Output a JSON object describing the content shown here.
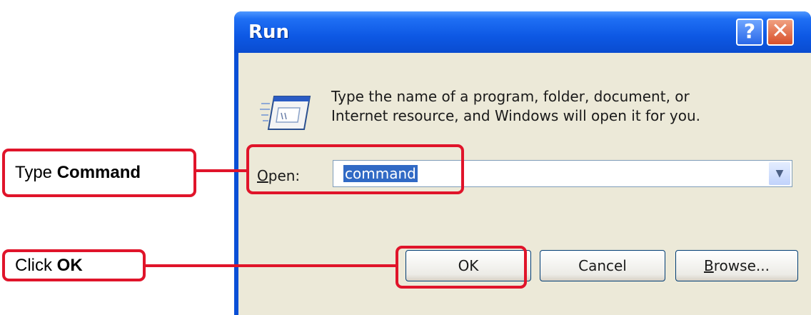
{
  "window": {
    "title": "Run",
    "help_label": "?",
    "close_label": "✕"
  },
  "run_dialog": {
    "icon": "run-program-icon",
    "message_line1": "Type the name of a program, folder, document, or",
    "message_line2": "Internet resource, and Windows will open it for you.",
    "open_label_accel": "O",
    "open_label_rest": "pen:",
    "open_value": "command",
    "dropdown_icon": "chevron-down-icon",
    "buttons": {
      "ok": "OK",
      "cancel": "Cancel",
      "browse_accel": "B",
      "browse_rest": "rowse..."
    }
  },
  "annotations": {
    "type_command_prefix": "Type ",
    "type_command_bold": "Command",
    "click_ok_prefix": "Click ",
    "click_ok_bold": "OK",
    "color": "#e0142a"
  },
  "colors": {
    "titlebar": "#0d58e4",
    "dialog_face": "#ece9d8",
    "selection": "#316ac5"
  }
}
